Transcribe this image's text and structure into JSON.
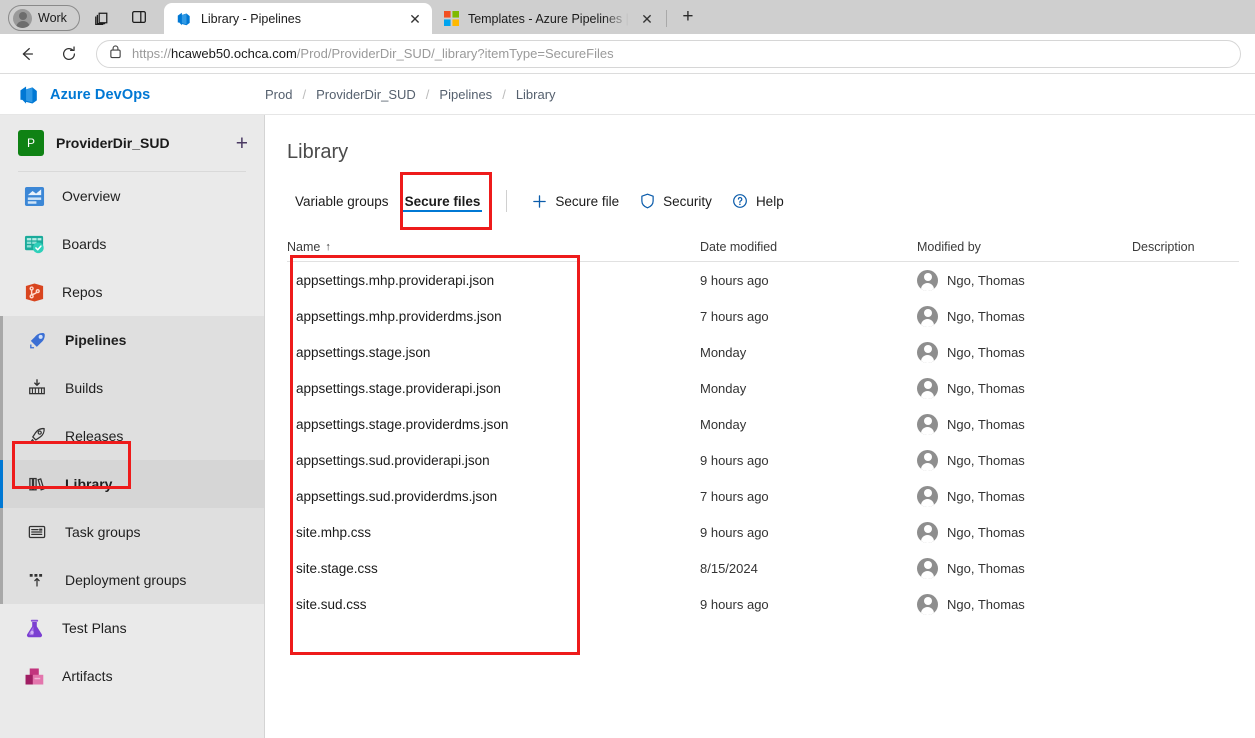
{
  "browser": {
    "profile_label": "Work",
    "icons": {
      "collections": "collections-icon",
      "split_screen": "split-screen-icon",
      "back": "back-arrow-icon",
      "reload": "reload-icon",
      "lock": "lock-icon",
      "new_tab": "plus-icon"
    },
    "tabs": [
      {
        "title": "Library - Pipelines",
        "favicon": "azure-devops-favicon",
        "active": true
      },
      {
        "title": "Templates - Azure Pipelines | Mic",
        "favicon": "microsoft-favicon",
        "active": false
      }
    ],
    "url": {
      "scheme": "https://",
      "host": "hcaweb50.ochca.com",
      "path": "/Prod/ProviderDir_SUD/_library?itemType=SecureFiles",
      "full": "https://hcaweb50.ochca.com/Prod/ProviderDir_SUD/_library?itemType=SecureFiles"
    }
  },
  "ado": {
    "brand": "Azure DevOps",
    "breadcrumb": [
      "Prod",
      "ProviderDir_SUD",
      "Pipelines",
      "Library"
    ],
    "breadcrumb_separator": "/"
  },
  "sidebar": {
    "project": {
      "initial": "P",
      "name": "ProviderDir_SUD",
      "add_label": "+"
    },
    "items": [
      {
        "label": "Overview",
        "icon": "overview-icon"
      },
      {
        "label": "Boards",
        "icon": "boards-icon"
      },
      {
        "label": "Repos",
        "icon": "repos-icon"
      },
      {
        "label": "Pipelines",
        "icon": "pipelines-icon"
      },
      {
        "label": "Builds",
        "icon": "builds-icon"
      },
      {
        "label": "Releases",
        "icon": "releases-icon"
      },
      {
        "label": "Library",
        "icon": "library-icon"
      },
      {
        "label": "Task groups",
        "icon": "task-groups-icon"
      },
      {
        "label": "Deployment groups",
        "icon": "deployment-groups-icon"
      },
      {
        "label": "Test Plans",
        "icon": "test-plans-icon"
      },
      {
        "label": "Artifacts",
        "icon": "artifacts-icon"
      }
    ],
    "selected": "Library"
  },
  "main": {
    "title": "Library",
    "pivots": [
      {
        "label": "Variable groups",
        "active": false
      },
      {
        "label": "Secure files",
        "active": true
      }
    ],
    "commands": [
      {
        "label": "Secure file",
        "icon": "plus-icon"
      },
      {
        "label": "Security",
        "icon": "shield-icon"
      },
      {
        "label": "Help",
        "icon": "question-circle-icon"
      }
    ],
    "table": {
      "columns": [
        "Name",
        "Date modified",
        "Modified by",
        "Description"
      ],
      "sort_column": "Name",
      "sort_direction": "↑",
      "rows": [
        {
          "name": "appsettings.mhp.providerapi.json",
          "date": "9 hours ago",
          "by": "Ngo, Thomas",
          "description": ""
        },
        {
          "name": "appsettings.mhp.providerdms.json",
          "date": "7 hours ago",
          "by": "Ngo, Thomas",
          "description": ""
        },
        {
          "name": "appsettings.stage.json",
          "date": "Monday",
          "by": "Ngo, Thomas",
          "description": ""
        },
        {
          "name": "appsettings.stage.providerapi.json",
          "date": "Monday",
          "by": "Ngo, Thomas",
          "description": ""
        },
        {
          "name": "appsettings.stage.providerdms.json",
          "date": "Monday",
          "by": "Ngo, Thomas",
          "description": ""
        },
        {
          "name": "appsettings.sud.providerapi.json",
          "date": "9 hours ago",
          "by": "Ngo, Thomas",
          "description": ""
        },
        {
          "name": "appsettings.sud.providerdms.json",
          "date": "7 hours ago",
          "by": "Ngo, Thomas",
          "description": ""
        },
        {
          "name": "site.mhp.css",
          "date": "9 hours ago",
          "by": "Ngo, Thomas",
          "description": ""
        },
        {
          "name": "site.stage.css",
          "date": "8/15/2024",
          "by": "Ngo, Thomas",
          "description": ""
        },
        {
          "name": "site.sud.css",
          "date": "9 hours ago",
          "by": "Ngo, Thomas",
          "description": ""
        }
      ]
    }
  },
  "annotations": {
    "color": "#ee1b1b",
    "boxes": [
      {
        "target": "sidebar-item-library"
      },
      {
        "target": "pivot-secure-files"
      },
      {
        "target": "secure-files-name-column"
      }
    ]
  }
}
